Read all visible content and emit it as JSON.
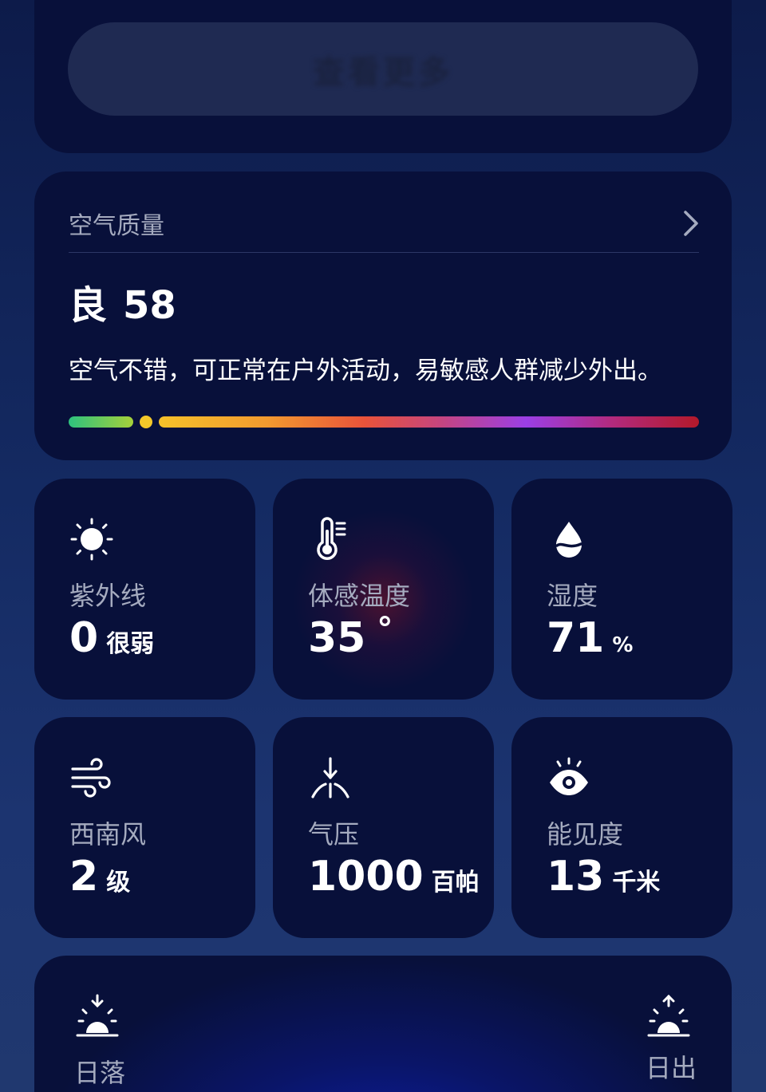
{
  "top_card": {
    "button_label": "查看更多"
  },
  "air_quality": {
    "title": "空气质量",
    "level": "良",
    "index": "58",
    "description": "空气不错，可正常在户外活动，易敏感人群减少外出。",
    "chevron_icon": "chevron-right-icon"
  },
  "tiles": [
    {
      "icon": "sun-icon",
      "label": "紫外线",
      "value": "0",
      "unit": "很弱"
    },
    {
      "icon": "thermometer-icon",
      "label": "体感温度",
      "value": "35",
      "unit": "°"
    },
    {
      "icon": "water-drop-icon",
      "label": "湿度",
      "value": "71",
      "unit": "%"
    },
    {
      "icon": "wind-icon",
      "label": "西南风",
      "value": "2",
      "unit": "级"
    },
    {
      "icon": "pressure-icon",
      "label": "气压",
      "value": "1000",
      "unit": "百帕"
    },
    {
      "icon": "eye-icon",
      "label": "能见度",
      "value": "13",
      "unit": "千米"
    }
  ],
  "sun": {
    "sunset_label": "日落",
    "sunrise_label": "日出"
  },
  "colors": {
    "card_bg": "#08103a",
    "label_gray": "#a5abbf",
    "page_bg_top": "#0d1b4a",
    "page_bg_bottom": "#20386f"
  }
}
